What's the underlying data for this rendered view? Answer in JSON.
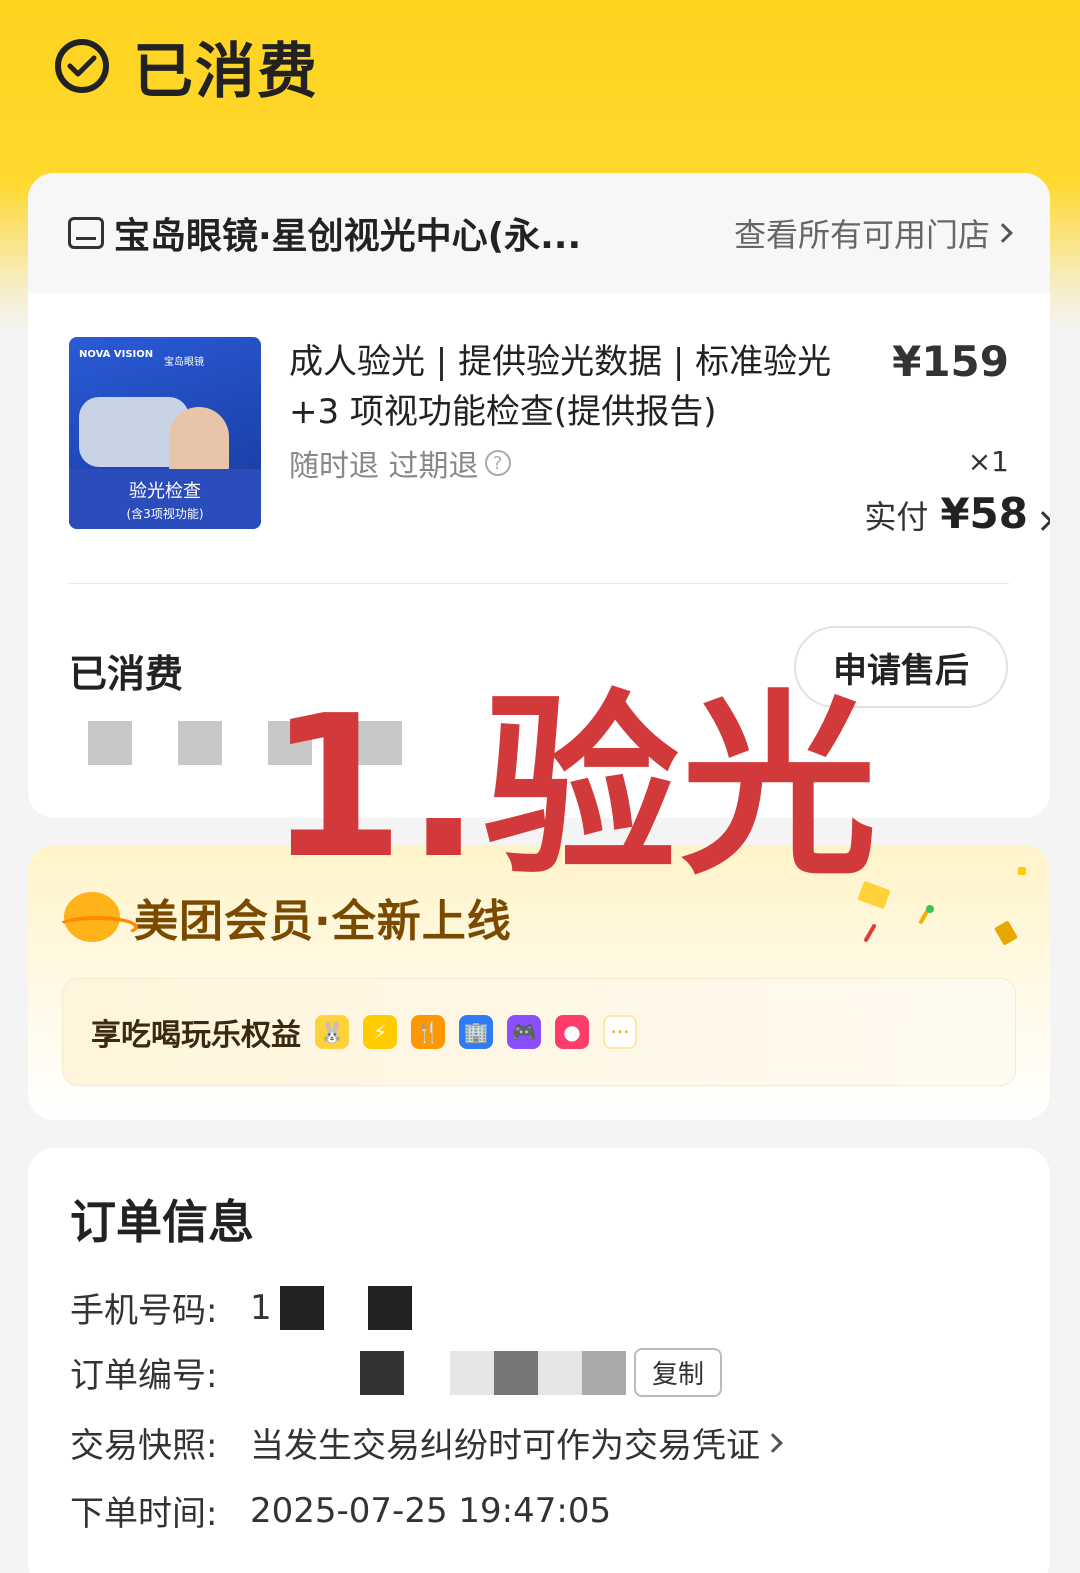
{
  "header": {
    "status_title": "已消费"
  },
  "store": {
    "name": "宝岛眼镜·星创视光中心(永...",
    "link": "查看所有可用门店"
  },
  "product": {
    "title": "成人验光 | 提供验光数据 | 标准验光+3 项视功能检查(提供报告)",
    "price": "¥159",
    "tags": "随时退 过期退",
    "qty": "×1",
    "paid_label": "实付",
    "paid_amount": "¥58",
    "thumb_text": "验光检查",
    "thumb_sub": "(含3项视功能)",
    "thumb_logo": "NOVA VISION",
    "thumb_logo2": "宝岛眼镜"
  },
  "consumption": {
    "label": "已消费",
    "after_sale_button": "申请售后"
  },
  "overlay": {
    "text": "1.验光"
  },
  "member": {
    "title": "美团会员·全新上线",
    "perks_text": "享吃喝玩乐权益"
  },
  "order": {
    "title": "订单信息",
    "phone_label": "手机号码:",
    "phone_value": "1",
    "number_label": "订单编号:",
    "copy_button": "复制",
    "snapshot_label": "交易快照:",
    "snapshot_value": "当发生交易纠纷时可作为交易凭证",
    "time_label": "下单时间:",
    "time_value": "2025-07-25 19:47:05"
  },
  "colors": {
    "brand_yellow": "#ffd21f",
    "overlay_red": "#d2393b"
  }
}
